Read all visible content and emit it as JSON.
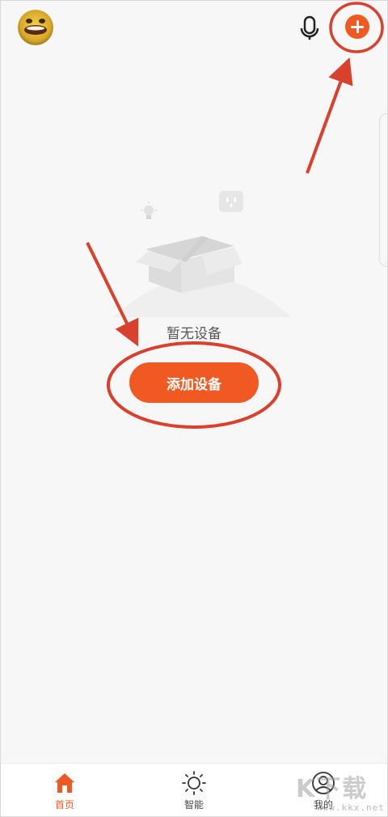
{
  "header": {
    "avatar_icon": "avatar-image",
    "mic_icon": "microphone-icon",
    "add_icon": "plus-icon"
  },
  "empty_state": {
    "illustration_icons": [
      "lightbulb-icon",
      "socket-icon",
      "open-box-icon"
    ],
    "message": "暂无设备",
    "add_button_label": "添加设备"
  },
  "bottom_nav": {
    "items": [
      {
        "label": "首页",
        "icon": "home-icon",
        "active": true
      },
      {
        "label": "智能",
        "icon": "sun-icon",
        "active": false
      },
      {
        "label": "我的",
        "icon": "user-icon",
        "active": false
      }
    ]
  },
  "watermark": {
    "big": "K下载",
    "small": "www.kkx.net"
  },
  "colors": {
    "accent": "#f05a22",
    "annotation": "#d9402e",
    "background": "#f7f7f7"
  }
}
